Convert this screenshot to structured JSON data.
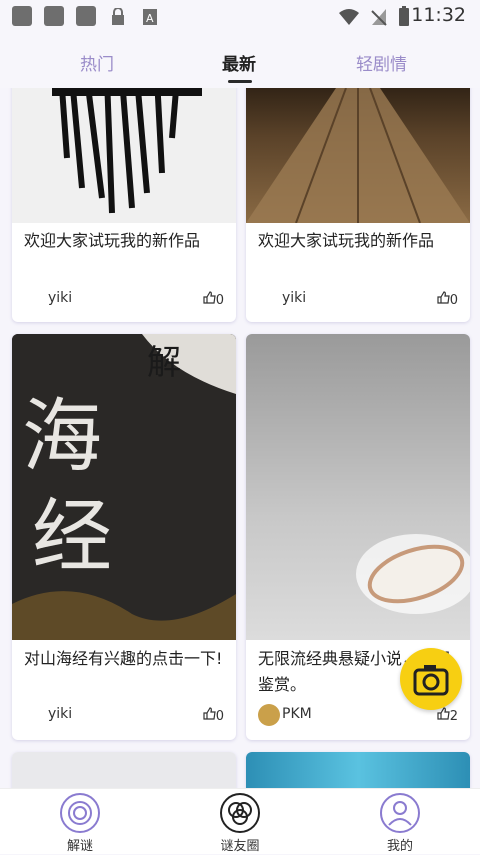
{
  "status": {
    "time": "11:32"
  },
  "tabs": [
    {
      "label": "热门"
    },
    {
      "label": "最新"
    },
    {
      "label": "轻剧情"
    }
  ],
  "cards": [
    {
      "title": "欢迎大家试玩我的新作品",
      "author": "yiki",
      "likes": "0"
    },
    {
      "title": "欢迎大家试玩我的新作品",
      "author": "yiki",
      "likes": "0"
    },
    {
      "title": "对山海经有兴趣的点击一下!",
      "author": "yiki",
      "likes": "0"
    },
    {
      "title": "无限流经典悬疑小说，欢迎鉴赏。",
      "author": "PKM",
      "likes": "2"
    }
  ],
  "bottom_nav": [
    {
      "label": "解谜"
    },
    {
      "label": "谜友圈"
    },
    {
      "label": "我的"
    }
  ],
  "colors": {
    "accent": "#8a7bd0",
    "camera": "#f7cf12"
  },
  "icons": [
    "thumbs-up-icon",
    "camera-icon",
    "fingerprint-icon",
    "circles-icon",
    "user-icon"
  ]
}
